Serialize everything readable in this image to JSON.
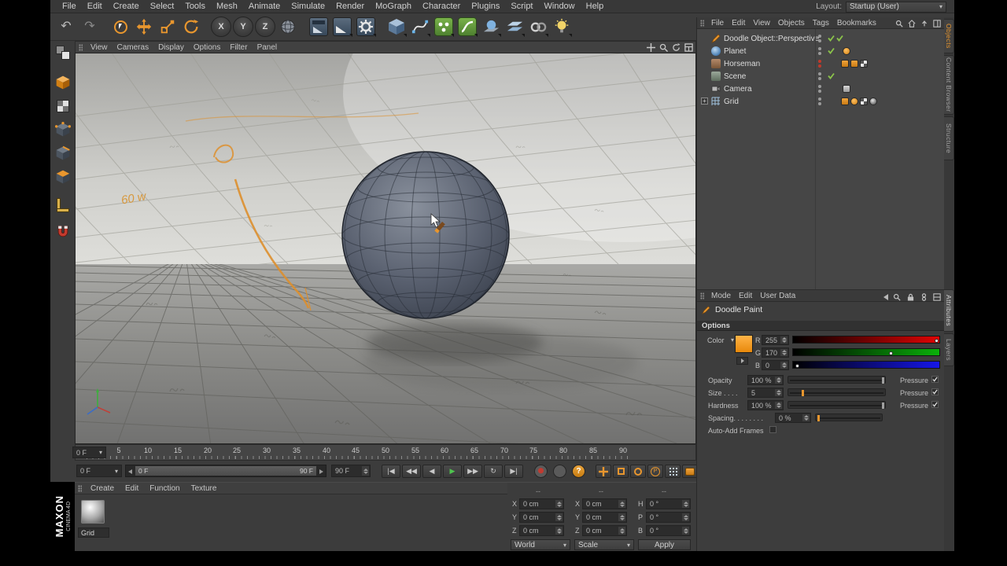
{
  "colors": {
    "accent_orange": "#e8962e",
    "green_check": "#8bc34a",
    "play_green": "#3fae3f",
    "doodle_orange": "#d8922e"
  },
  "icons": {
    "undo": "↶",
    "redo": "↷",
    "dropdown": "▾",
    "plus": "+",
    "help": "?",
    "param": "P",
    "axis": [
      "X",
      "Y",
      "Z"
    ],
    "transport": [
      "|◀",
      "◀◀",
      "◀",
      "▶",
      "▶▶",
      "↻",
      "▶|"
    ]
  },
  "menubar": {
    "items": [
      "File",
      "Edit",
      "Create",
      "Select",
      "Tools",
      "Mesh",
      "Animate",
      "Simulate",
      "Render",
      "MoGraph",
      "Character",
      "Plugins",
      "Script",
      "Window",
      "Help"
    ],
    "layout_label": "Layout:",
    "layout_value": "Startup (User)"
  },
  "viewport": {
    "menu": [
      "View",
      "Cameras",
      "Display",
      "Options",
      "Filter",
      "Panel"
    ],
    "doodle_text": "60 w"
  },
  "timeline": {
    "ticks": [
      "0",
      "5",
      "10",
      "15",
      "20",
      "25",
      "30",
      "35",
      "40",
      "45",
      "50",
      "55",
      "60",
      "65",
      "70",
      "75",
      "80",
      "85",
      "90"
    ],
    "frame_end_box": "0 F"
  },
  "transport": {
    "current": "0 F",
    "range_start": "0 F",
    "range_end": "90 F",
    "end_frame": "90 F"
  },
  "materials": {
    "menu": [
      "Create",
      "Edit",
      "Function",
      "Texture"
    ],
    "items": [
      {
        "name": "Grid"
      }
    ]
  },
  "coordinates": {
    "headers": [
      "--",
      "--",
      "--"
    ],
    "rows": [
      {
        "c1_label": "X",
        "c1_value": "0 cm",
        "c2_label": "X",
        "c2_value": "0 cm",
        "c3_label": "H",
        "c3_value": "0 °"
      },
      {
        "c1_label": "Y",
        "c1_value": "0 cm",
        "c2_label": "Y",
        "c2_value": "0 cm",
        "c3_label": "P",
        "c3_value": "0 °"
      },
      {
        "c1_label": "Z",
        "c1_value": "0 cm",
        "c2_label": "Z",
        "c2_value": "0 cm",
        "c3_label": "B",
        "c3_value": "0 °"
      }
    ],
    "dropdown1": "World",
    "dropdown2": "Scale",
    "apply": "Apply"
  },
  "object_manager": {
    "menu": [
      "File",
      "Edit",
      "View",
      "Objects",
      "Tags",
      "Bookmarks"
    ],
    "objects": [
      {
        "name": "Doodle Object::Perspective"
      },
      {
        "name": "Planet"
      },
      {
        "name": "Horseman"
      },
      {
        "name": "Scene"
      },
      {
        "name": "Camera"
      },
      {
        "name": "Grid"
      }
    ]
  },
  "attributes": {
    "menu": [
      "Mode",
      "Edit",
      "User Data"
    ],
    "title": "Doodle Paint",
    "section": "Options",
    "color_label": "Color",
    "rgb": [
      {
        "label": "R",
        "value": "255"
      },
      {
        "label": "G",
        "value": "170"
      },
      {
        "label": "B",
        "value": "0"
      }
    ],
    "rows": [
      {
        "label": "Opacity",
        "value": "100 %",
        "pressure": "Pressure"
      },
      {
        "label": "Size . . . .",
        "value": "5",
        "pressure": "Pressure"
      },
      {
        "label": "Hardness",
        "value": "100 %",
        "pressure": "Pressure"
      },
      {
        "label": "Spacing. . . . . . . .",
        "value": "0 %"
      }
    ],
    "auto_add_label": "Auto-Add Frames"
  },
  "side_tabs": {
    "top": [
      "Objects",
      "Content Browser",
      "Structure"
    ],
    "bottom": [
      "Attributes",
      "Layers"
    ]
  },
  "branding": {
    "maxon": "MAXON",
    "cinema": "CINEMA 4D"
  }
}
